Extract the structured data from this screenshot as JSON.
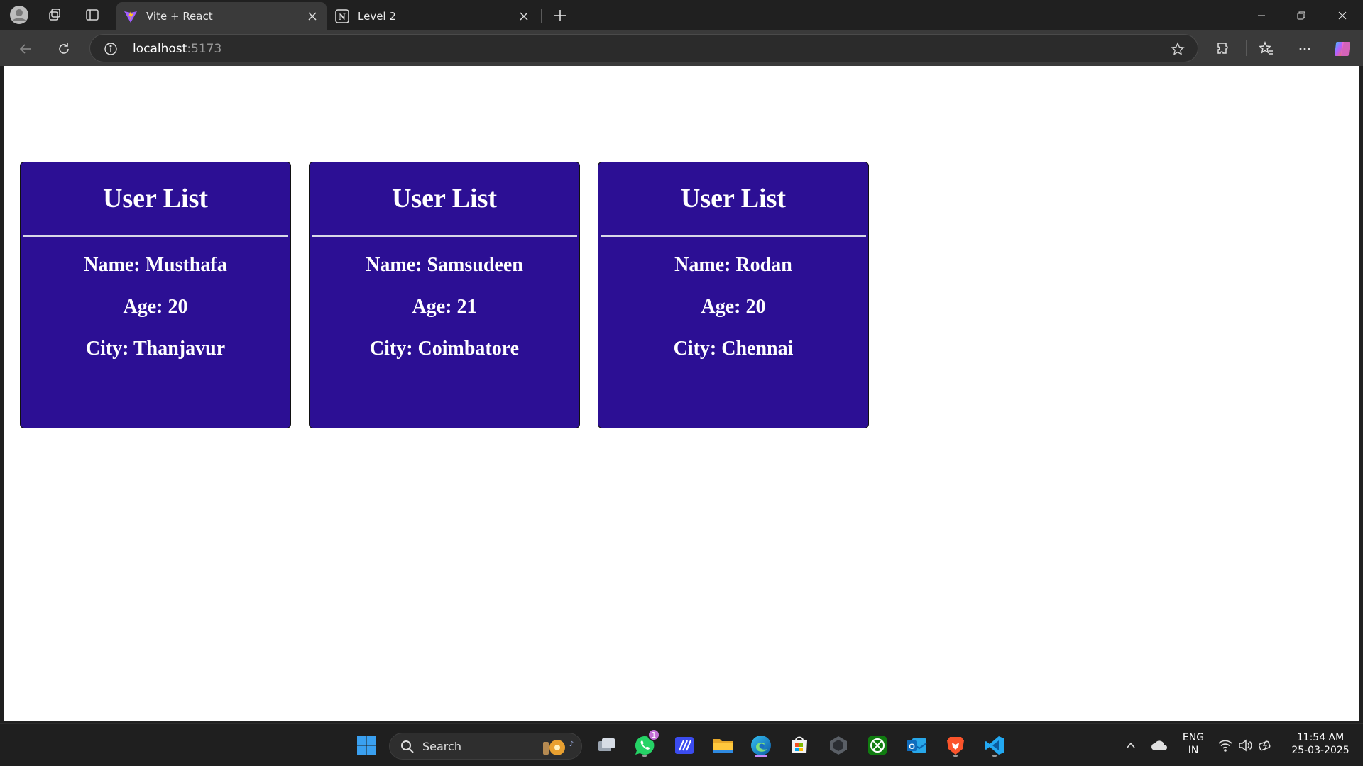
{
  "browser": {
    "tabs": [
      {
        "title": "Vite + React",
        "active": true,
        "favicon": "vite-icon"
      },
      {
        "title": "Level 2",
        "active": false,
        "favicon": "notion-icon"
      }
    ],
    "address": {
      "host": "localhost",
      "port": ":5173"
    }
  },
  "page": {
    "cards": [
      {
        "title": "User List",
        "name": "Name: Musthafa",
        "age": "Age: 20",
        "city": "City: Thanjavur"
      },
      {
        "title": "User List",
        "name": "Name: Samsudeen",
        "age": "Age: 21",
        "city": "City: Coimbatore"
      },
      {
        "title": "User List",
        "name": "Name: Rodan",
        "age": "Age: 20",
        "city": "City: Chennai"
      }
    ],
    "card_color": "#2c0f94"
  },
  "taskbar": {
    "search_label": "Search",
    "whatsapp_badge": "1",
    "language": {
      "line1": "ENG",
      "line2": "IN"
    },
    "clock": {
      "time": "11:54 AM",
      "date": "25-03-2025"
    }
  }
}
